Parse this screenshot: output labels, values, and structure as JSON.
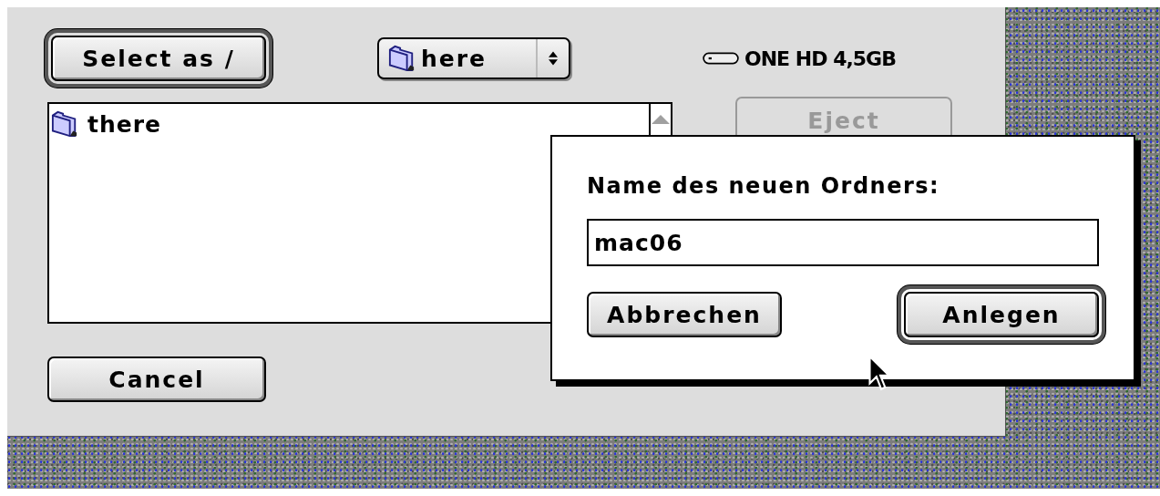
{
  "dialog": {
    "select_button": {
      "label": "Select as /",
      "default": true
    },
    "folder_popup": {
      "label": "here"
    },
    "volume": {
      "label": "ONE HD 4,5GB"
    },
    "eject_button": {
      "label": "Eject",
      "disabled": true
    },
    "file_list": {
      "items": [
        {
          "name": "there",
          "selected": false
        }
      ]
    },
    "cancel_button": {
      "label": "Cancel",
      "default": false
    }
  },
  "new_folder_dialog": {
    "prompt": "Name des neuen Ordners:",
    "name_field": {
      "value": "mac06"
    },
    "buttons": [
      {
        "label": "Abbrechen",
        "default": false
      },
      {
        "label": "Anlegen",
        "default": true
      }
    ]
  }
}
